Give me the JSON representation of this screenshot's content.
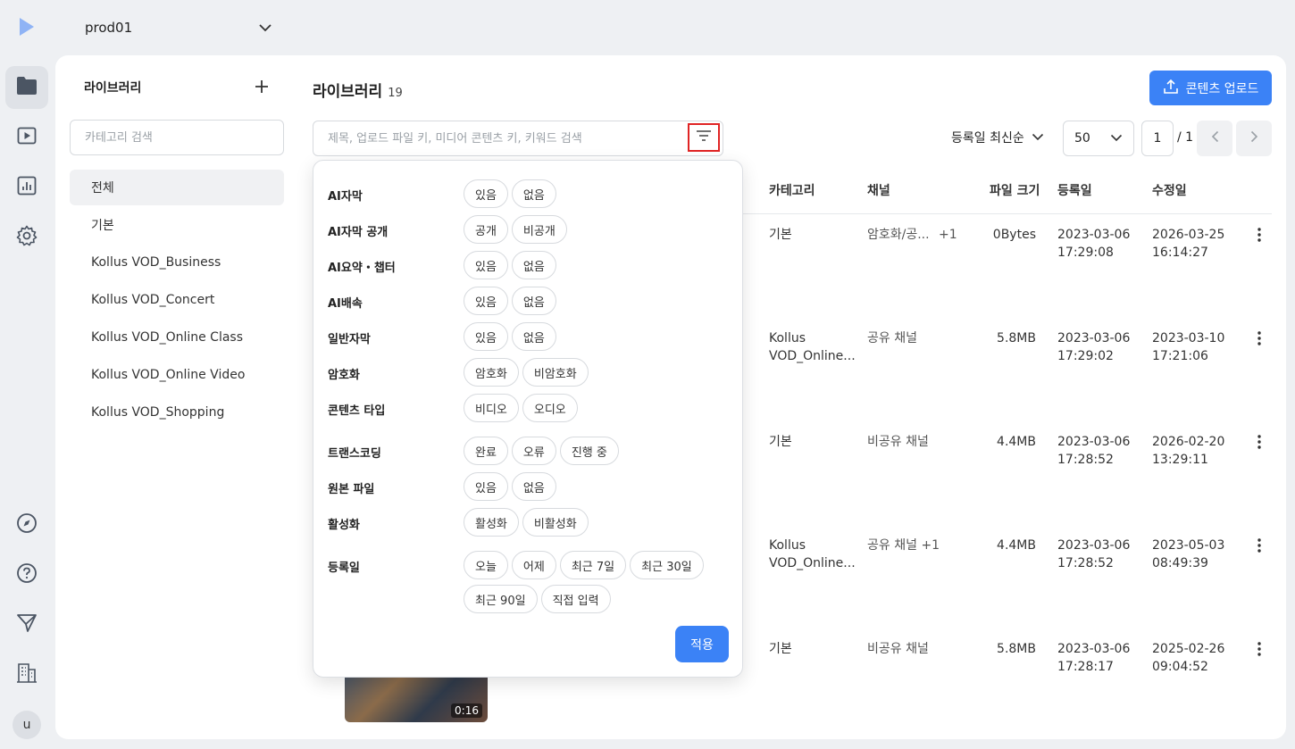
{
  "project": {
    "name": "prod01"
  },
  "user": {
    "initial": "u"
  },
  "library": {
    "title": "라이브러리",
    "search_placeholder": "카테고리 검색",
    "categories": [
      "전체",
      "기본",
      "Kollus VOD_Business",
      "Kollus VOD_Concert",
      "Kollus VOD_Online Class",
      "Kollus VOD_Online Video",
      "Kollus VOD_Shopping"
    ]
  },
  "main": {
    "title": "라이브러리",
    "count": "19",
    "upload_label": "콘텐츠 업로드",
    "search_placeholder": "제목, 업로드 파일 키, 미디어 콘텐츠 키, 키워드 검색",
    "sort_label": "등록일 최신순",
    "per_page": "50",
    "page_current": "1",
    "page_total": "/ 1"
  },
  "table": {
    "headers": [
      "카테고리",
      "채널",
      "파일 크기",
      "등록일",
      "수정일"
    ],
    "rows": [
      {
        "category": [
          "기본",
          ""
        ],
        "channel": "암호화/공...",
        "channel_extra": "+1",
        "size": "0Bytes",
        "created": [
          "2023-03-06",
          "17:29:08"
        ],
        "modified": [
          "2026-03-25",
          "16:14:27"
        ]
      },
      {
        "category": [
          "Kollus",
          "VOD_Online..."
        ],
        "channel": "공유 채널",
        "channel_extra": "",
        "size": "5.8MB",
        "created": [
          "2023-03-06",
          "17:29:02"
        ],
        "modified": [
          "2023-03-10",
          "17:21:06"
        ]
      },
      {
        "category": [
          "기본",
          ""
        ],
        "channel": "비공유 채널",
        "channel_extra": "",
        "size": "4.4MB",
        "created": [
          "2023-03-06",
          "17:28:52"
        ],
        "modified": [
          "2026-02-20",
          "13:29:11"
        ]
      },
      {
        "category": [
          "Kollus",
          "VOD_Online..."
        ],
        "channel": "공유 채널",
        "channel_extra": "+1",
        "size": "4.4MB",
        "created": [
          "2023-03-06",
          "17:28:52"
        ],
        "modified": [
          "2023-05-03",
          "08:49:39"
        ]
      },
      {
        "category": [
          "기본",
          ""
        ],
        "channel": "비공유 채널",
        "channel_extra": "",
        "size": "5.8MB",
        "created": [
          "2023-03-06",
          "17:28:17"
        ],
        "modified": [
          "2025-02-26",
          "09:04:52"
        ]
      }
    ],
    "thumb_duration": "0:16"
  },
  "filter": {
    "apply_label": "적용",
    "groups": [
      {
        "label": "AI자막",
        "options": [
          "있음",
          "없음"
        ]
      },
      {
        "label": "AI자막 공개",
        "options": [
          "공개",
          "비공개"
        ]
      },
      {
        "label": "AI요약・챕터",
        "options": [
          "있음",
          "없음"
        ]
      },
      {
        "label": "AI배속",
        "options": [
          "있음",
          "없음"
        ]
      },
      {
        "label": "일반자막",
        "options": [
          "있음",
          "없음"
        ]
      },
      {
        "label": "암호화",
        "options": [
          "암호화",
          "비암호화"
        ]
      },
      {
        "label": "콘텐츠 타입",
        "options": [
          "비디오",
          "오디오"
        ]
      },
      {
        "label": "트랜스코딩",
        "options": [
          "완료",
          "오류",
          "진행 중"
        ]
      },
      {
        "label": "원본 파일",
        "options": [
          "있음",
          "없음"
        ]
      },
      {
        "label": "활성화",
        "options": [
          "활성화",
          "비활성화"
        ]
      },
      {
        "label": "등록일",
        "options": [
          "오늘",
          "어제",
          "최근 7일",
          "최근 30일",
          "최근 90일",
          "직접 입력"
        ]
      }
    ]
  },
  "colors": {
    "accent": "#3b82f6",
    "highlight_border": "#e02424"
  }
}
